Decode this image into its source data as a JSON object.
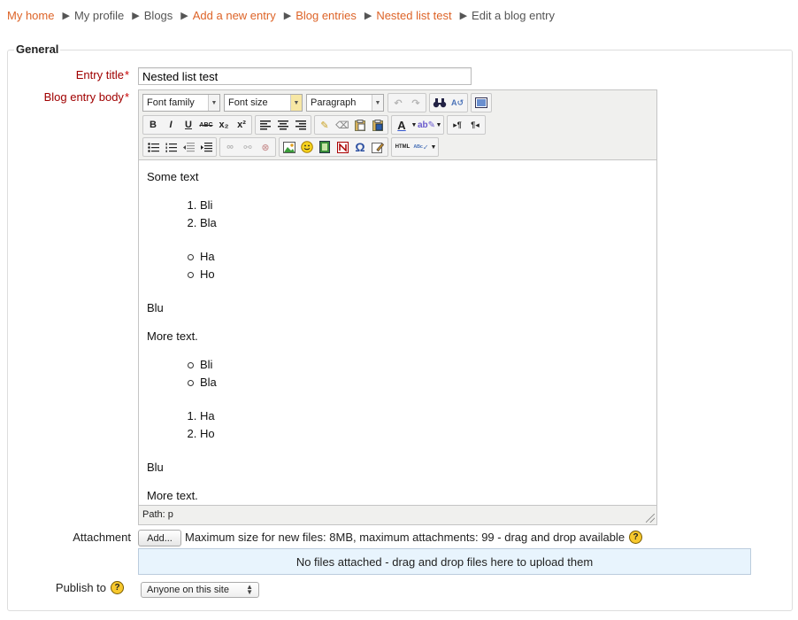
{
  "breadcrumb": [
    {
      "label": "My home",
      "link": true
    },
    {
      "label": "My profile",
      "link": false
    },
    {
      "label": "Blogs",
      "link": false
    },
    {
      "label": "Add a new entry",
      "link": true
    },
    {
      "label": "Blog entries",
      "link": true
    },
    {
      "label": "Nested list test",
      "link": true
    },
    {
      "label": "Edit a blog entry",
      "link": false
    }
  ],
  "form": {
    "legend": "General",
    "entry_title_label": "Entry title",
    "entry_title_value": "Nested list test",
    "body_label": "Blog entry body",
    "required_marker": "*",
    "attachment_label": "Attachment",
    "add_button": "Add...",
    "attachment_info": "Maximum size for new files: 8MB, maximum attachments: 99 - drag and drop available",
    "dropzone_text": "No files attached - drag and drop files here to upload them",
    "publish_label": "Publish to",
    "publish_value": "Anyone on this site",
    "help_glyph": "?"
  },
  "editor": {
    "font_family": "Font family",
    "font_size": "Font size",
    "format": "Paragraph",
    "path": "Path: p",
    "content": {
      "p1": "Some text",
      "ol1": [
        "Bli",
        "Bla"
      ],
      "ul1": [
        "Ha",
        "Ho"
      ],
      "p2": "Blu",
      "p3": "More text.",
      "ul2": [
        "Bli",
        "Bla"
      ],
      "ol2": [
        "Ha",
        "Ho"
      ],
      "p4": "Blu",
      "p5": "More text."
    },
    "toolbar": {
      "bold": "B",
      "italic": "I",
      "underline": "U",
      "strike": "ABC",
      "subscript": "x₂",
      "superscript": "x²",
      "font_color": "A",
      "omega": "Ω",
      "html": "HTML"
    }
  },
  "colors": {
    "link": "#dd6327",
    "required": "#a00000",
    "dropzone_bg": "#e8f4fd",
    "help_icon": "#f7c82d"
  },
  "icons": [
    "undo-icon",
    "redo-icon",
    "find-icon",
    "replace-icon",
    "fullscreen-icon",
    "cleanup-icon",
    "eraser-icon",
    "paste-text-icon",
    "paste-word-icon",
    "highlight-icon",
    "ltr-icon",
    "rtl-icon",
    "bullet-list-icon",
    "numbered-list-icon",
    "outdent-icon",
    "indent-icon",
    "link-icon",
    "unlink-icon",
    "anchor-icon",
    "image-icon",
    "emoticon-icon",
    "media-icon",
    "nolink-icon",
    "special-char-icon",
    "edit-icon",
    "spellcheck-icon"
  ]
}
